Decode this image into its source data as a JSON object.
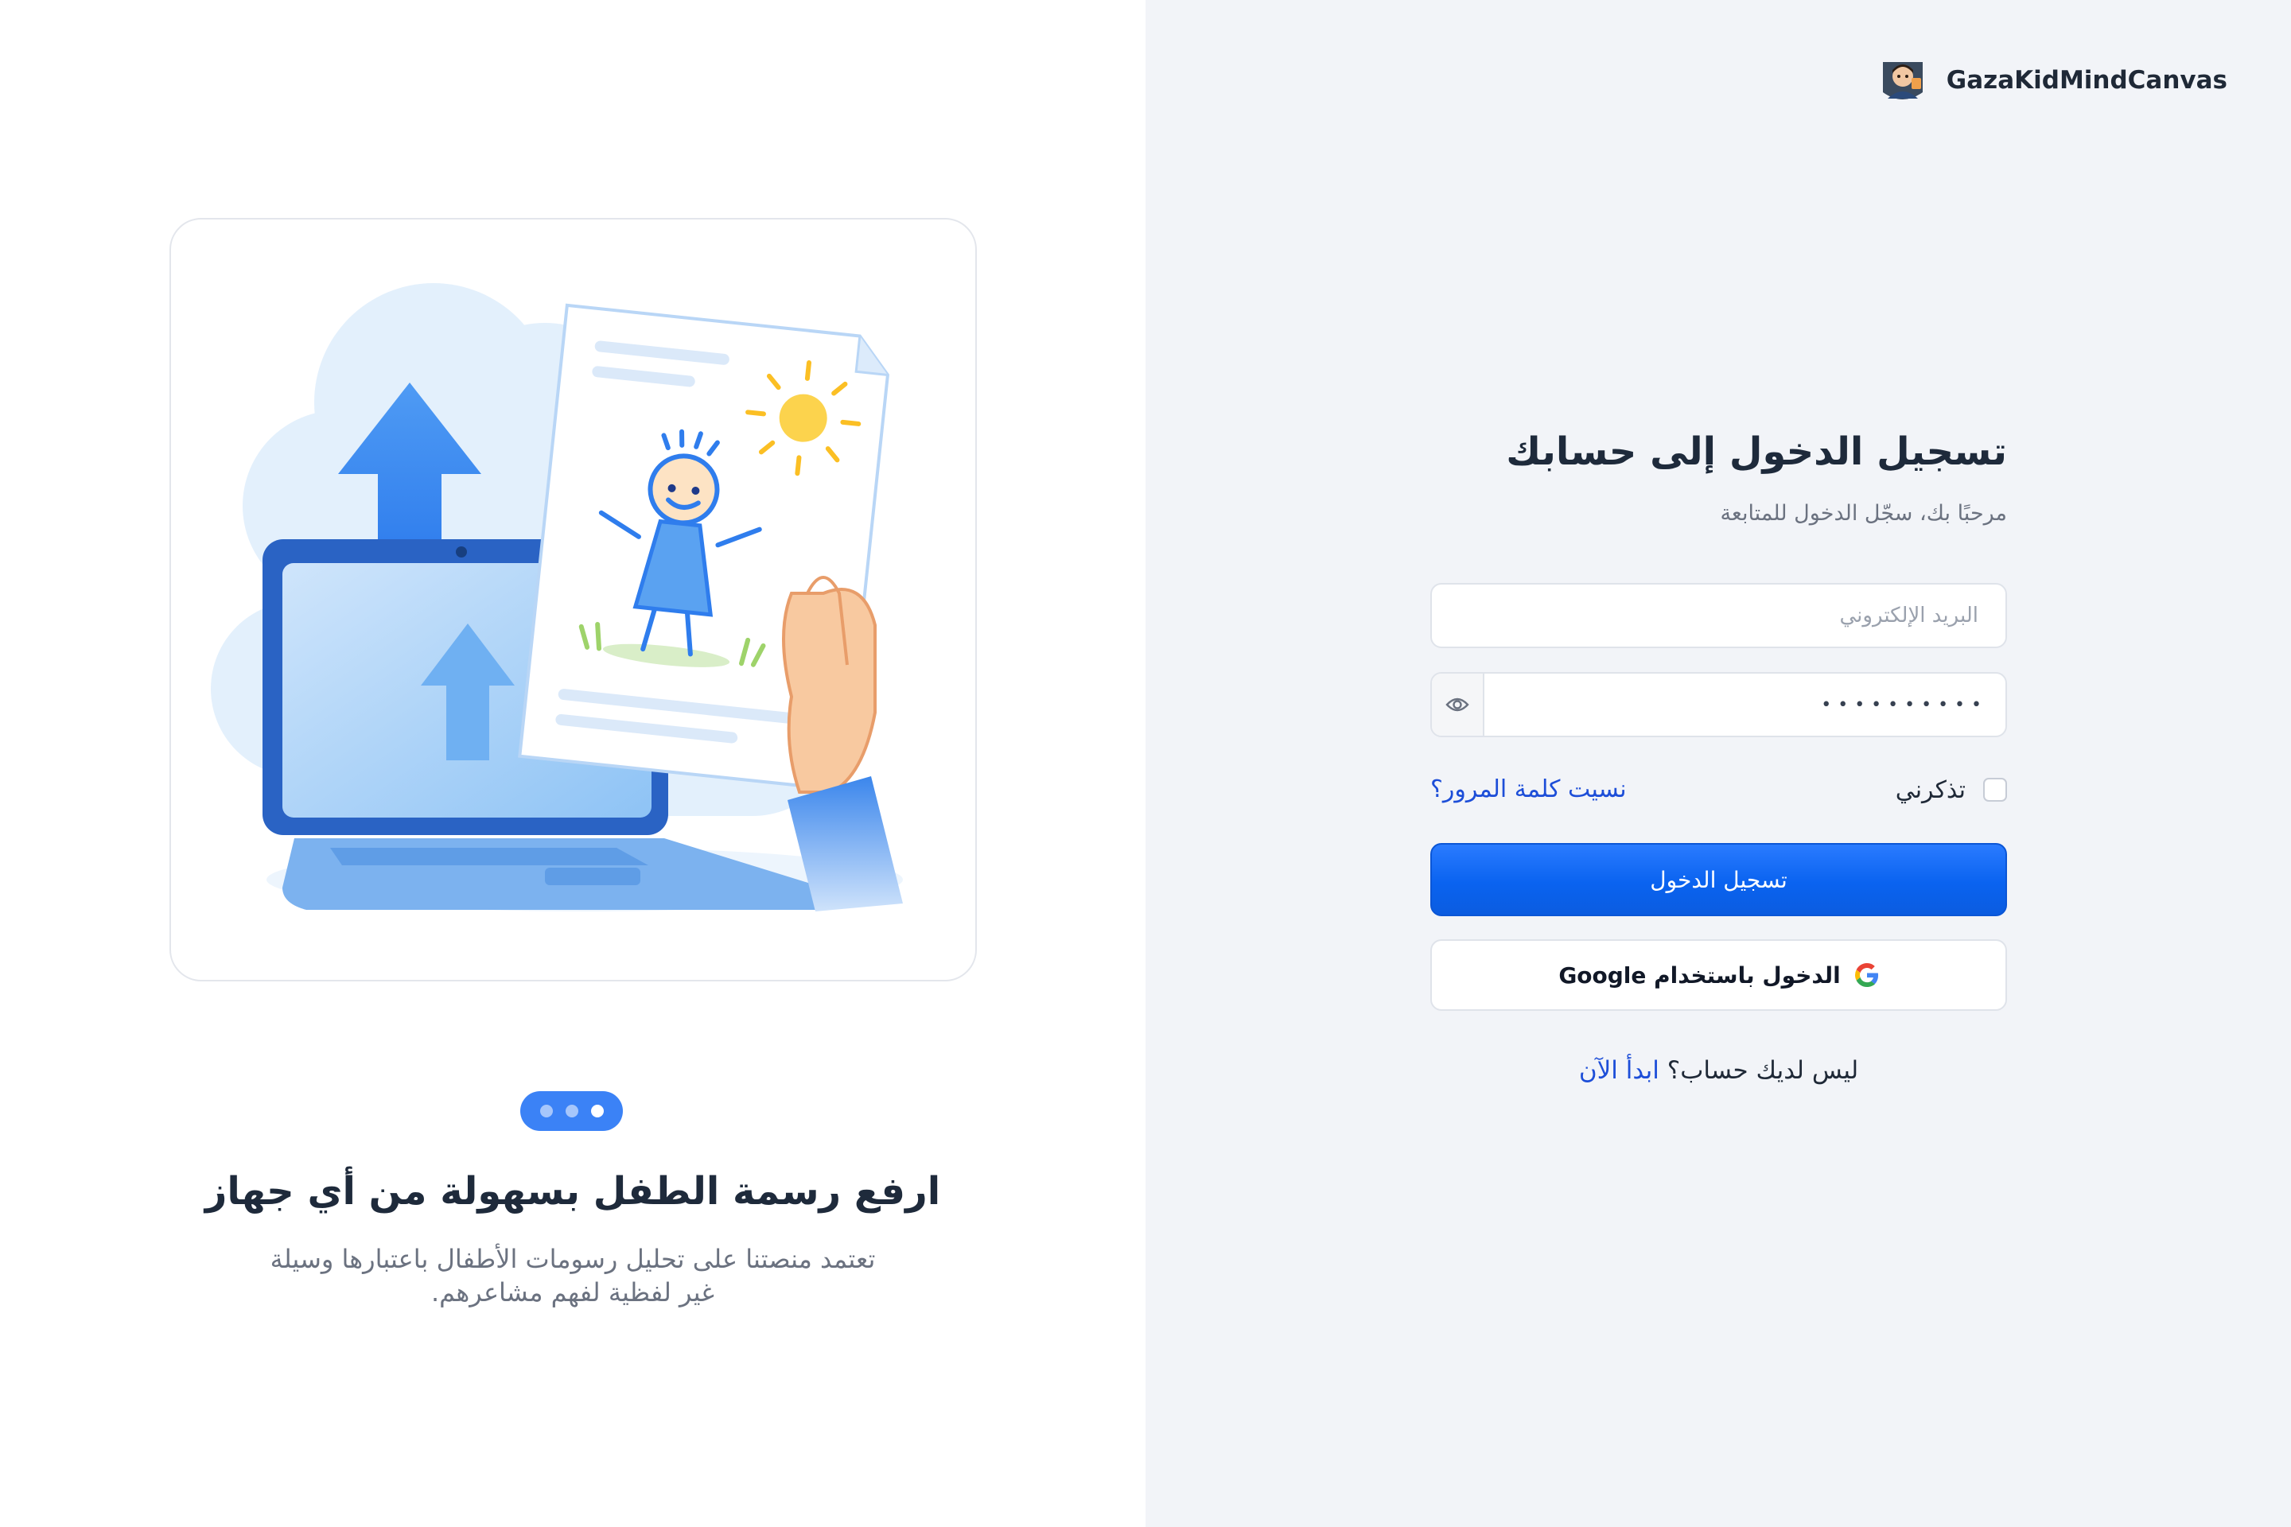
{
  "brand": {
    "name": "GazaKidMindCanvas",
    "logo_icon": "avatar-logo-icon"
  },
  "carousel": {
    "active_index": 2,
    "dot_count": 3,
    "title": "ارفع رسمة الطفل بسهولة من أي جهاز",
    "description": "تعتمد منصتنا على تحليل رسومات الأطفال باعتبارها وسيلة غير لفظية لفهم مشاعرهم.",
    "illustration_icon": "upload-drawing-illustration"
  },
  "login": {
    "title": "تسجيل الدخول إلى حسابك",
    "subtitle": "مرحبًا بك، سجّل الدخول للمتابعة",
    "email_placeholder": "البريد الإلكتروني",
    "email_value": "",
    "password_value": "••••••••••",
    "password_toggle_icon": "eye-icon",
    "remember_label": "تذكرني",
    "remember_checked": false,
    "forgot_label": "نسيت كلمة المرور؟",
    "submit_label": "تسجيل الدخول",
    "google_label": "الدخول باستخدام Google",
    "google_icon": "google-icon",
    "no_account_text": "ليس لديك حساب؟",
    "signup_link": "ابدأ الآن"
  },
  "colors": {
    "primary": "#0a63f0",
    "link": "#1d4ed8",
    "right_bg": "#f2f4f8",
    "heading": "#1e2a3b",
    "muted": "#6b7280"
  }
}
